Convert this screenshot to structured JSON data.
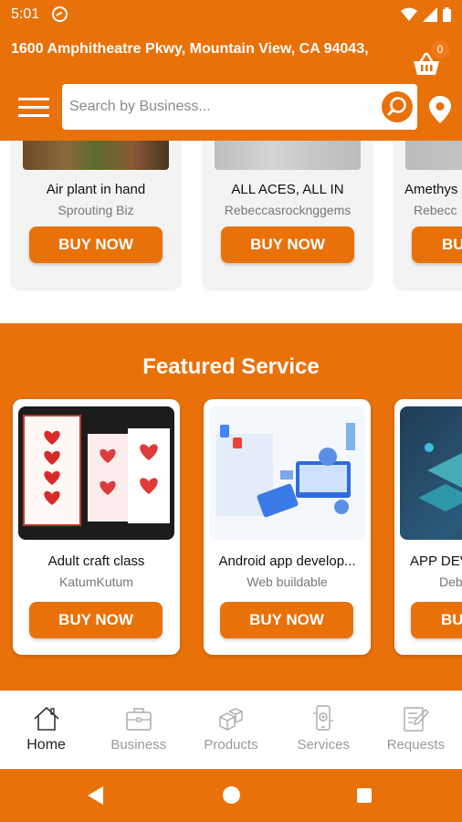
{
  "status_bar": {
    "time": "5:01"
  },
  "header": {
    "address": "1600 Amphitheatre Pkwy, Mountain View, CA 94043,",
    "cart_count": "0",
    "search_placeholder": "Search by Business..."
  },
  "products": [
    {
      "title": "Air plant in hand",
      "subtitle": "Sprouting Biz",
      "button": "BUY NOW"
    },
    {
      "title": "ALL ACES, ALL IN",
      "subtitle": "Rebeccasrocknggems",
      "button": "BUY NOW"
    },
    {
      "title": "Amethys",
      "subtitle": "Rebecc",
      "button": "BU"
    }
  ],
  "featured": {
    "title": "Featured Service",
    "items": [
      {
        "title": "Adult craft class",
        "subtitle": "KatumKutum",
        "button": "BUY NOW"
      },
      {
        "title": "Android app develop...",
        "subtitle": "Web buildable",
        "button": "BUY NOW"
      },
      {
        "title": "APP DEV",
        "subtitle": "Deb",
        "button": "BU"
      }
    ]
  },
  "bottom_nav": [
    {
      "label": "Home",
      "icon": "home-icon",
      "active": true
    },
    {
      "label": "Business",
      "icon": "briefcase-icon",
      "active": false
    },
    {
      "label": "Products",
      "icon": "boxes-icon",
      "active": false
    },
    {
      "label": "Services",
      "icon": "services-icon",
      "active": false
    },
    {
      "label": "Requests",
      "icon": "requests-icon",
      "active": false
    }
  ],
  "colors": {
    "primary": "#e8710a",
    "text": "#111111",
    "muted": "#777777"
  }
}
